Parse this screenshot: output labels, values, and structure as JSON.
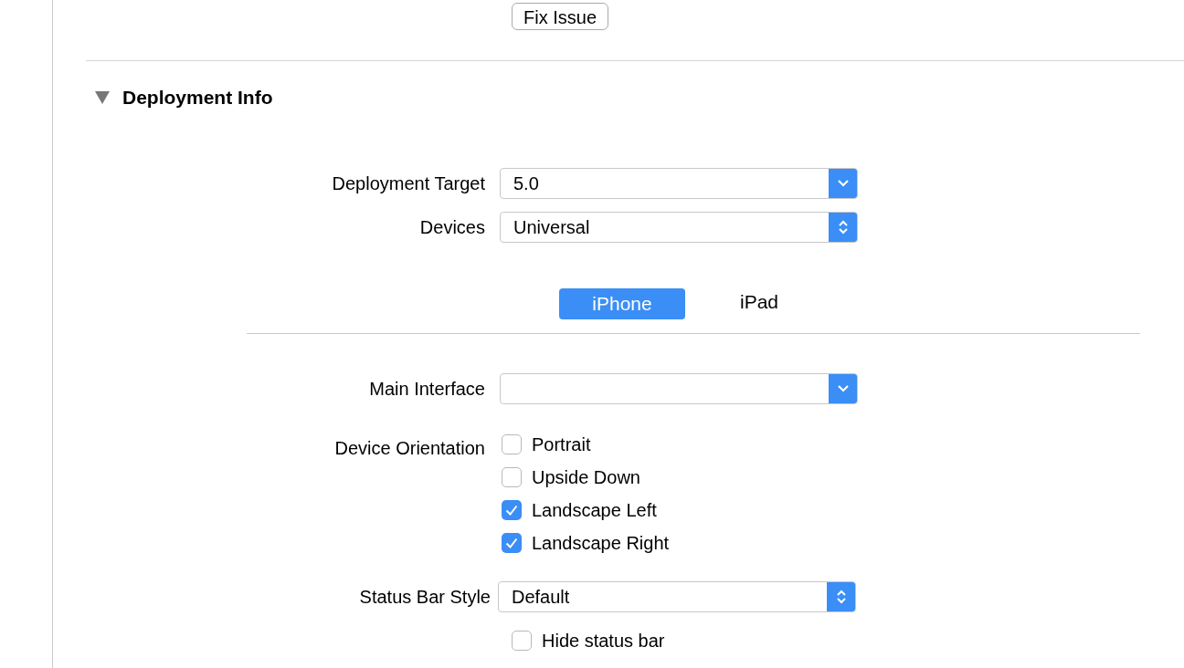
{
  "fix_button": "Fix Issue",
  "section": {
    "title": "Deployment Info",
    "expanded": true
  },
  "general_fields": [
    {
      "label": "Deployment Target",
      "value": "5.0",
      "kind": "dropdown"
    },
    {
      "label": "Devices",
      "value": "Universal",
      "kind": "popup"
    }
  ],
  "device_tabs": [
    {
      "label": "iPhone",
      "selected": true
    },
    {
      "label": "iPad",
      "selected": false
    }
  ],
  "main_interface": {
    "label": "Main Interface",
    "kind": "dropdown"
  },
  "device_orientation": {
    "label": "Device Orientation",
    "options": [
      {
        "label": "Portrait",
        "checked": false
      },
      {
        "label": "Upside Down",
        "checked": false
      },
      {
        "label": "Landscape Left",
        "checked": true
      },
      {
        "label": "Landscape Right",
        "checked": true
      }
    ]
  },
  "status_bar_style": {
    "label": "Status Bar Style",
    "value": "Default",
    "kind": "popup"
  },
  "hide_status_bar": {
    "label": "Hide status bar",
    "checked": false
  }
}
